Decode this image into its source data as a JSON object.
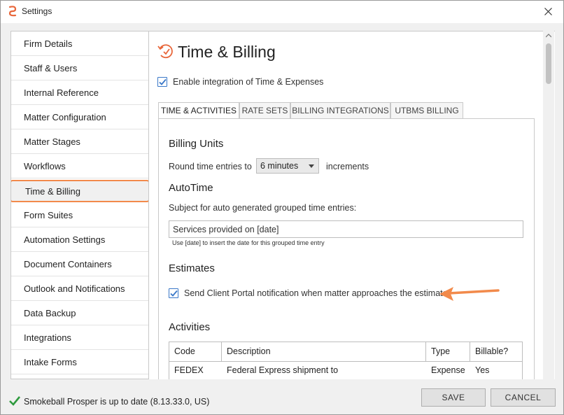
{
  "window": {
    "title": "Settings"
  },
  "sidebar": {
    "items": [
      {
        "label": "Firm Details"
      },
      {
        "label": "Staff & Users"
      },
      {
        "label": "Internal Reference"
      },
      {
        "label": "Matter Configuration"
      },
      {
        "label": "Matter Stages"
      },
      {
        "label": "Workflows"
      },
      {
        "label": "Time & Billing",
        "active": true
      },
      {
        "label": "Form Suites"
      },
      {
        "label": "Automation Settings"
      },
      {
        "label": "Document Containers"
      },
      {
        "label": "Outlook and Notifications"
      },
      {
        "label": "Data Backup"
      },
      {
        "label": "Integrations"
      },
      {
        "label": "Intake Forms"
      }
    ]
  },
  "main": {
    "title": "Time & Billing",
    "enable_integration": {
      "label": "Enable integration of Time & Expenses",
      "checked": true
    },
    "tabs": [
      {
        "label": "TIME & ACTIVITIES",
        "active": true
      },
      {
        "label": "RATE SETS"
      },
      {
        "label": "BILLING INTEGRATIONS"
      },
      {
        "label": "UTBMS BILLING"
      }
    ],
    "billing_units": {
      "heading": "Billing Units",
      "round_label": "Round time entries to",
      "round_value": "6 minutes",
      "increments_label": "increments"
    },
    "autotime": {
      "heading": "AutoTime",
      "subject_label": "Subject for auto generated grouped time entries:",
      "subject_value": "Services provided on [date]",
      "hint": "Use [date] to insert the date for this grouped time entry"
    },
    "estimates": {
      "heading": "Estimates",
      "notify_label": "Send Client Portal notification when matter approaches the estimate",
      "notify_checked": true
    },
    "activities": {
      "heading": "Activities",
      "columns": [
        "Code",
        "Description",
        "Type",
        "Billable?"
      ],
      "rows": [
        [
          "FEDEX",
          "Federal Express shipment to",
          "Expense",
          "Yes"
        ]
      ]
    }
  },
  "footer": {
    "status": "Smokeball Prosper is up to date (8.13.33.0, US)",
    "save_label": "SAVE",
    "cancel_label": "CANCEL"
  },
  "colors": {
    "accent_orange": "#f28a4b",
    "checkbox_blue": "#3a78c8",
    "status_green": "#2e9a3e"
  }
}
